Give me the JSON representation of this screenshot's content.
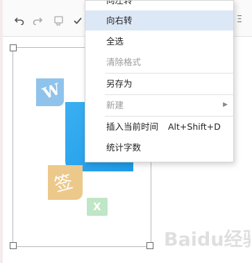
{
  "toolbar": {
    "buttons": [
      {
        "icon": "undo-icon"
      },
      {
        "icon": "redo-icon"
      },
      {
        "icon": "format-painter-icon"
      },
      {
        "icon": "check-icon"
      }
    ],
    "right_icon": "dropdown-icon"
  },
  "menu": {
    "items": [
      {
        "label": "向左转",
        "enabled": true
      },
      {
        "label": "向右转",
        "enabled": true,
        "highlighted": true
      },
      {
        "label": "全选",
        "enabled": true
      },
      {
        "label": "清除格式",
        "enabled": false
      },
      {
        "label": "另存为",
        "enabled": true
      },
      {
        "label": "新建",
        "enabled": false,
        "submenu": true
      },
      {
        "label": "插入当前时间",
        "shortcut": "Alt+Shift+D",
        "enabled": true
      },
      {
        "label": "统计字数",
        "enabled": true
      }
    ]
  },
  "canvas": {
    "tile_w_letter": "W",
    "tile_x_letter": "X",
    "tile_sign_glyph": "签"
  },
  "watermark": {
    "text": "Baidu经验"
  },
  "colors": {
    "highlight": "#dde8f7",
    "tile_blue": "#1d9be8",
    "tile_w": "#8fc3ec",
    "tile_sign": "#ecc98a",
    "tile_x": "#bfe6c6"
  }
}
